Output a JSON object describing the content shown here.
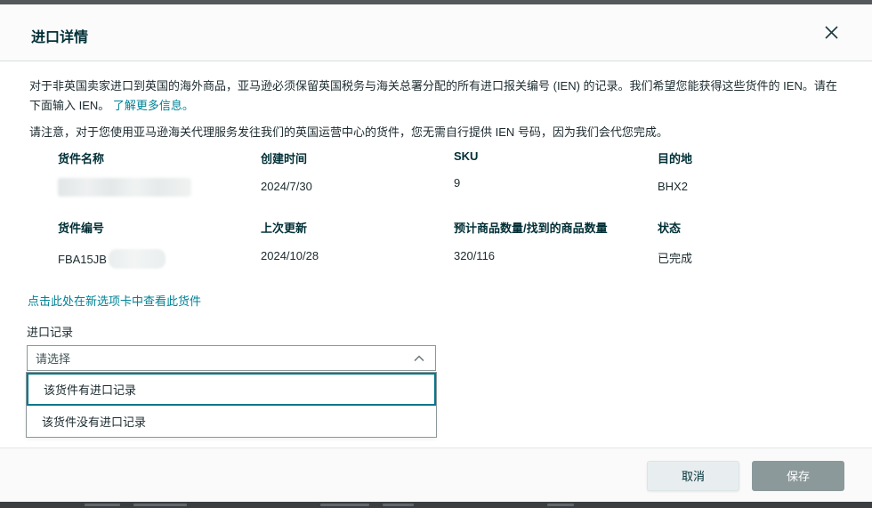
{
  "modal": {
    "title": "进口详情",
    "intro": "对于非英国卖家进口到英国的海外商品，亚马逊必须保留英国税务与海关总署分配的所有进口报关编号 (IEN) 的记录。我们希望您能获得这些货件的 IEN。请在下面输入 IEN。",
    "learn_more": "了解更多信息。",
    "note": "请注意，对于您使用亚马逊海关代理服务发往我们的英国运营中心的货件，您无需自行提供 IEN 号码，因为我们会代您完成。"
  },
  "details": {
    "rows": [
      {
        "cells": [
          {
            "label": "货件名称",
            "value": "",
            "redacted": true
          },
          {
            "label": "创建时间",
            "value": "2024/7/30"
          },
          {
            "label": "SKU",
            "value": "9"
          },
          {
            "label": "目的地",
            "value": "BHX2"
          }
        ]
      },
      {
        "cells": [
          {
            "label": "货件编号",
            "value": "FBA15JB",
            "redacted_suffix": true
          },
          {
            "label": "上次更新",
            "value": "2024/10/28"
          },
          {
            "label": "预计商品数量/找到的商品数量",
            "value": "320/116"
          },
          {
            "label": "状态",
            "value": "已完成"
          }
        ]
      }
    ]
  },
  "view_shipment_link": "点击此处在新选项卡中查看此货件",
  "import_record": {
    "label": "进口记录",
    "placeholder": "请选择",
    "options": [
      "该货件有进口记录",
      "该货件没有进口记录"
    ],
    "expanded": true,
    "focused_option_index": 0
  },
  "footer": {
    "cancel": "取消",
    "save": "保存"
  },
  "icons": {
    "close": "close-icon",
    "chevron": "chevron-up-icon"
  },
  "colors": {
    "link_teal": "#008296",
    "focus_teal": "#00778c",
    "title_text": "#002f36",
    "body_text": "#1b2a2e",
    "save_button_bg": "#8b999b",
    "cancel_button_bg": "#e8eeef",
    "select_border": "#8b9799",
    "header_bg": "#fbfbfb",
    "footer_bg": "#fafafa",
    "top_strip": "#54585a",
    "bottom_strip": "#3a3e41"
  }
}
